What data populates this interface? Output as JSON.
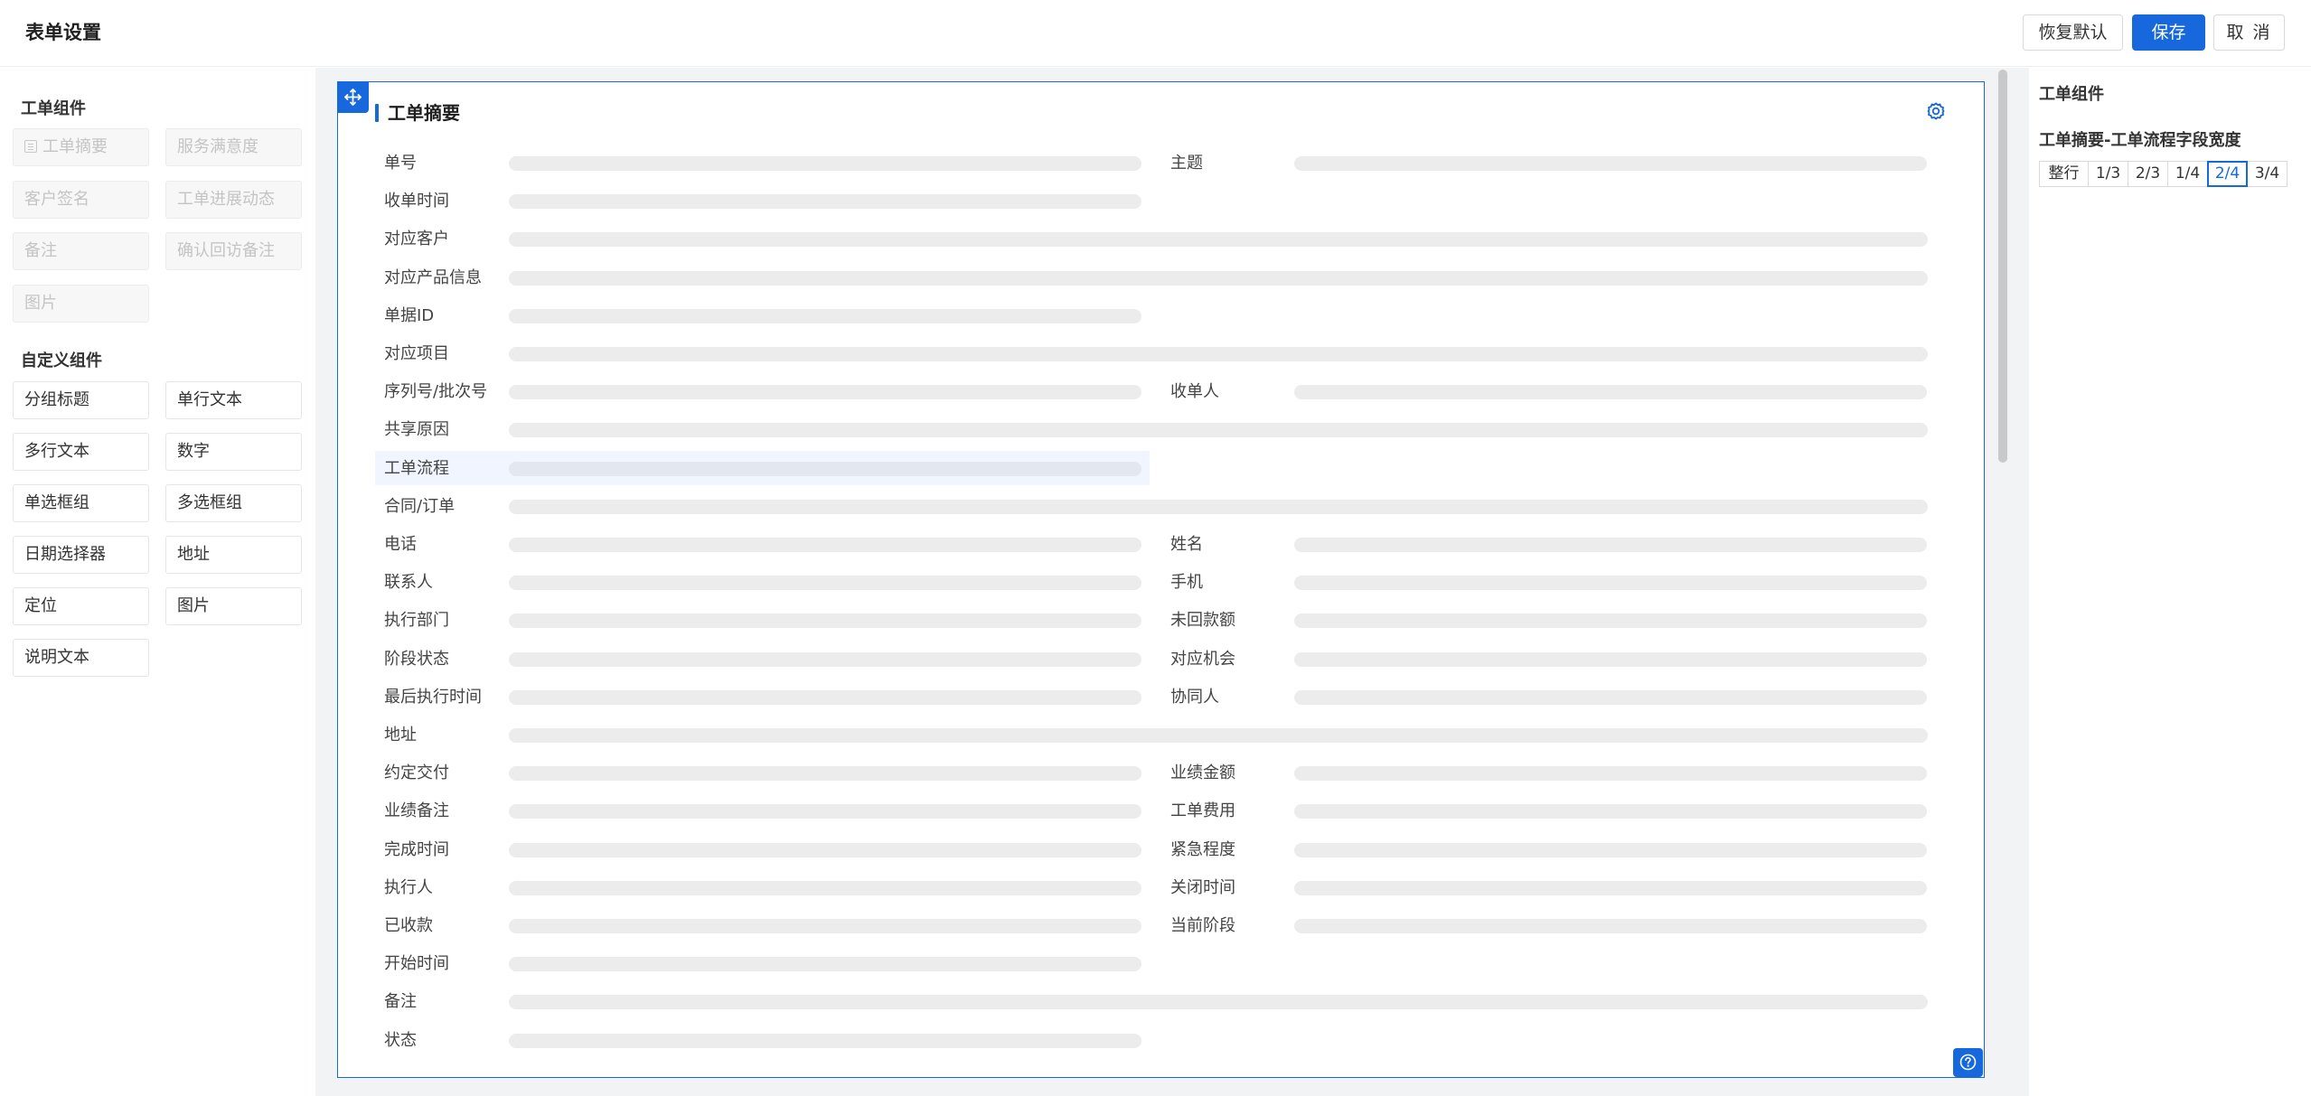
{
  "header": {
    "title": "表单设置",
    "restore_label": "恢复默认",
    "save_label": "保存",
    "cancel_label": "取 消"
  },
  "left": {
    "builtin_title": "工单组件",
    "builtin": [
      "工单摘要",
      "服务满意度",
      "客户签名",
      "工单进展动态",
      "备注",
      "确认回访备注",
      "图片"
    ],
    "custom_title": "自定义组件",
    "custom": [
      "分组标题",
      "单行文本",
      "多行文本",
      "数字",
      "单选框组",
      "多选框组",
      "日期选择器",
      "地址",
      "定位",
      "图片",
      "说明文本"
    ]
  },
  "card": {
    "title": "工单摘要",
    "fields": [
      {
        "label": "单号",
        "width": "half"
      },
      {
        "label": "主题",
        "width": "half"
      },
      {
        "label": "收单时间",
        "width": "half"
      },
      {
        "label": "对应客户",
        "width": "full"
      },
      {
        "label": "对应产品信息",
        "width": "full"
      },
      {
        "label": "单据ID",
        "width": "half"
      },
      {
        "label": "对应项目",
        "width": "full"
      },
      {
        "label": "序列号/批次号",
        "width": "half"
      },
      {
        "label": "收单人",
        "width": "half"
      },
      {
        "label": "共享原因",
        "width": "full"
      },
      {
        "label": "工单流程",
        "width": "half",
        "selected": true
      },
      {
        "label": "合同/订单",
        "width": "full"
      },
      {
        "label": "电话",
        "width": "half"
      },
      {
        "label": "姓名",
        "width": "half"
      },
      {
        "label": "联系人",
        "width": "half"
      },
      {
        "label": "手机",
        "width": "half"
      },
      {
        "label": "执行部门",
        "width": "half"
      },
      {
        "label": "未回款额",
        "width": "half"
      },
      {
        "label": "阶段状态",
        "width": "half"
      },
      {
        "label": "对应机会",
        "width": "half"
      },
      {
        "label": "最后执行时间",
        "width": "half"
      },
      {
        "label": "协同人",
        "width": "half"
      },
      {
        "label": "地址",
        "width": "full"
      },
      {
        "label": "约定交付",
        "width": "half"
      },
      {
        "label": "业绩金额",
        "width": "half"
      },
      {
        "label": "业绩备注",
        "width": "half"
      },
      {
        "label": "工单费用",
        "width": "half"
      },
      {
        "label": "完成时间",
        "width": "half"
      },
      {
        "label": "紧急程度",
        "width": "half"
      },
      {
        "label": "执行人",
        "width": "half"
      },
      {
        "label": "关闭时间",
        "width": "half"
      },
      {
        "label": "已收款",
        "width": "half"
      },
      {
        "label": "当前阶段",
        "width": "half"
      },
      {
        "label": "开始时间",
        "width": "half"
      },
      {
        "label": "备注",
        "width": "full"
      },
      {
        "label": "状态",
        "width": "half"
      }
    ]
  },
  "right": {
    "title": "工单组件",
    "subtitle": "工单摘要-工单流程字段宽度",
    "widths": [
      "整行",
      "1/3",
      "2/3",
      "1/4",
      "2/4",
      "3/4"
    ],
    "selected_width": "2/4"
  },
  "colors": {
    "primary": "#1668dc",
    "skeleton": "#ececec",
    "selected_row_bg": "#f0f5ff"
  }
}
